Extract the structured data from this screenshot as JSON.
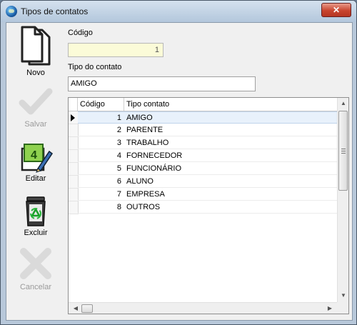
{
  "window": {
    "title": "Tipos de contatos",
    "close_label": "✕"
  },
  "toolbar": {
    "novo": "Novo",
    "salvar": "Salvar",
    "editar": "Editar",
    "excluir": "Excluir",
    "cancelar": "Cancelar"
  },
  "form": {
    "codigo_label": "Código",
    "codigo_value": "1",
    "tipo_label": "Tipo do contato",
    "tipo_value": "AMIGO"
  },
  "grid": {
    "columns": [
      "Código",
      "Tipo contato"
    ],
    "rows": [
      {
        "codigo": "1",
        "tipo": "AMIGO"
      },
      {
        "codigo": "2",
        "tipo": "PARENTE"
      },
      {
        "codigo": "3",
        "tipo": "TRABALHO"
      },
      {
        "codigo": "4",
        "tipo": "FORNECEDOR"
      },
      {
        "codigo": "5",
        "tipo": "FUNCIONÁRIO"
      },
      {
        "codigo": "6",
        "tipo": "ALUNO"
      },
      {
        "codigo": "7",
        "tipo": "EMPRESA"
      },
      {
        "codigo": "8",
        "tipo": "OUTROS"
      }
    ],
    "selected_index": 0
  },
  "icons": {
    "novo": "new-document-icon",
    "salvar": "checkmark-icon",
    "editar": "edit-icon",
    "excluir": "recycle-bin-icon",
    "cancelar": "x-cancel-icon"
  }
}
